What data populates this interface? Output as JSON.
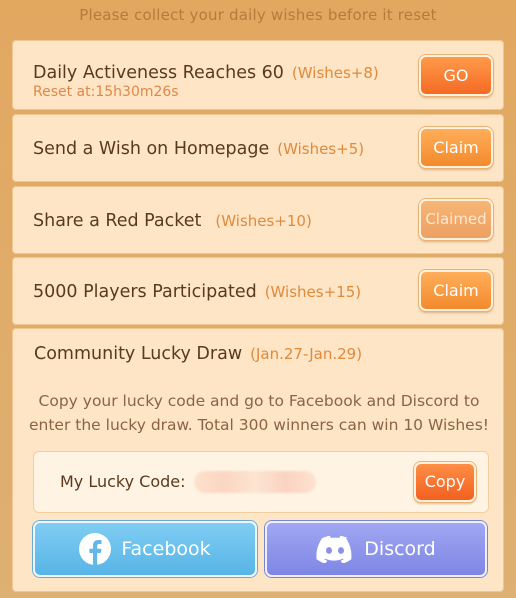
{
  "header": {
    "note": "Please collect your daily wishes before it reset"
  },
  "tasks": [
    {
      "title": "Daily Activeness Reaches 60",
      "reward": "(Wishes+8)",
      "sub": "Reset at:15h30m26s",
      "button": "GO",
      "state": "go"
    },
    {
      "title": "Send a Wish on Homepage",
      "reward": "(Wishes+5)",
      "button": "Claim",
      "state": "claim"
    },
    {
      "title": "Share a Red Packet",
      "reward": "(Wishes+10)",
      "button": "Claimed",
      "state": "claimed"
    },
    {
      "title": "5000 Players Participated",
      "reward": "(Wishes+15)",
      "button": "Claim",
      "state": "claim"
    }
  ],
  "lucky_draw": {
    "title": "Community Lucky Draw",
    "dates": "(Jan.27-Jan.29)",
    "desc_line1": "Copy your lucky code and go to Facebook and Discord to",
    "desc_line2": "enter the lucky draw. Total 300 winners can win 10 Wishes!",
    "code_label": "My Lucky Code:",
    "copy_label": "Copy",
    "facebook_label": "Facebook",
    "discord_label": "Discord",
    "icons": {
      "facebook": "facebook-icon",
      "discord": "discord-icon"
    }
  },
  "colors": {
    "button_orange": "#f46a23",
    "facebook_blue": "#58b4e6",
    "discord_purple": "#7d86e4"
  }
}
